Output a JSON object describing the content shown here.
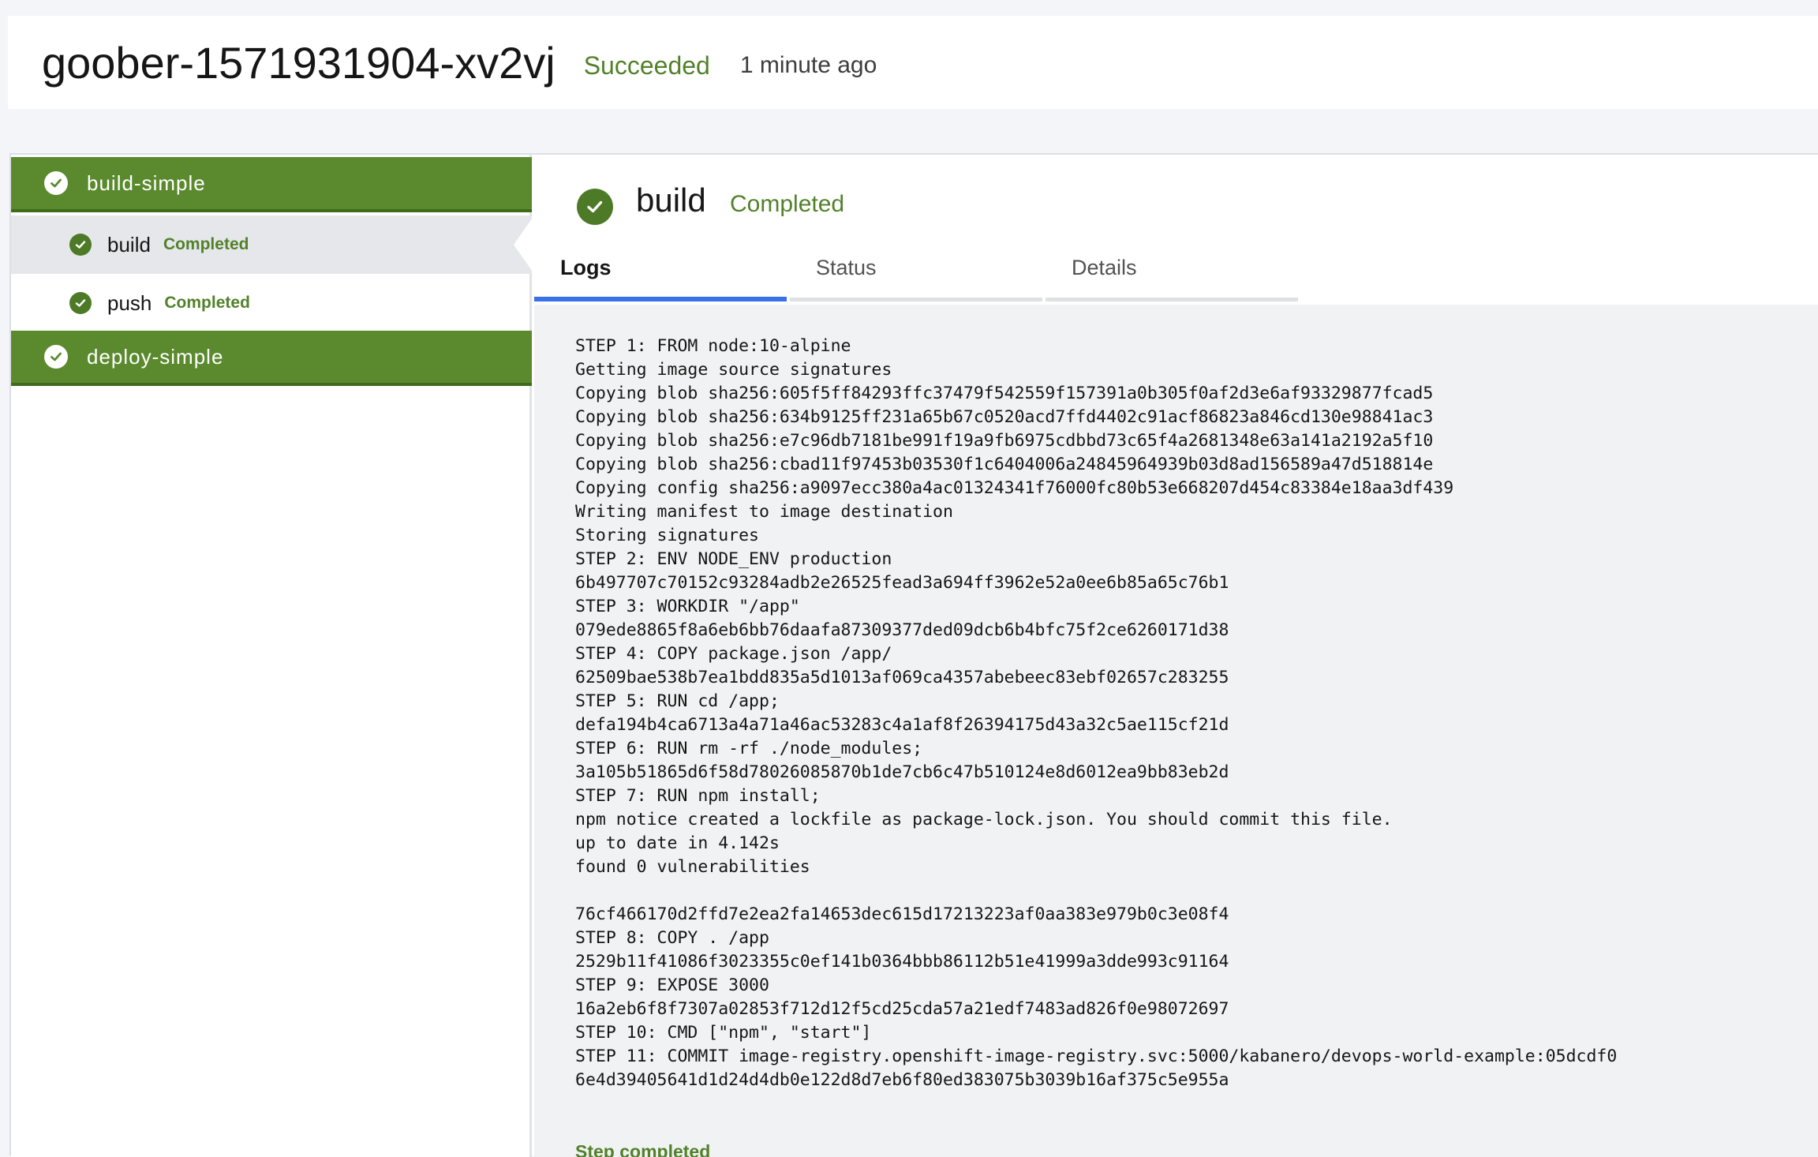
{
  "header": {
    "run_name": "goober-1571931904-xv2vj",
    "status": "Succeeded",
    "time": "1 minute ago"
  },
  "colors": {
    "success": "#52812a",
    "task_bg": "#5a8a2d",
    "tab_active": "#3a71e8"
  },
  "sidebar": {
    "tasks": [
      {
        "label": "build-simple",
        "icon": "check-circle-icon",
        "steps": [
          {
            "label": "build",
            "status": "Completed",
            "selected": true
          },
          {
            "label": "push",
            "status": "Completed",
            "selected": false
          }
        ]
      },
      {
        "label": "deploy-simple",
        "icon": "check-circle-icon",
        "steps": []
      }
    ]
  },
  "step": {
    "title": "build",
    "status": "Completed",
    "tabs": [
      "Logs",
      "Status",
      "Details"
    ],
    "active_tab": "Logs"
  },
  "logs": {
    "lines": [
      "STEP 1: FROM node:10-alpine",
      "Getting image source signatures",
      "Copying blob sha256:605f5ff84293ffc37479f542559f157391a0b305f0af2d3e6af93329877fcad5",
      "Copying blob sha256:634b9125ff231a65b67c0520acd7ffd4402c91acf86823a846cd130e98841ac3",
      "Copying blob sha256:e7c96db7181be991f19a9fb6975cdbbd73c65f4a2681348e63a141a2192a5f10",
      "Copying blob sha256:cbad11f97453b03530f1c6404006a24845964939b03d8ad156589a47d518814e",
      "Copying config sha256:a9097ecc380a4ac01324341f76000fc80b53e668207d454c83384e18aa3df439",
      "Writing manifest to image destination",
      "Storing signatures",
      "STEP 2: ENV NODE_ENV production",
      "6b497707c70152c93284adb2e26525fead3a694ff3962e52a0ee6b85a65c76b1",
      "STEP 3: WORKDIR \"/app\"",
      "079ede8865f8a6eb6bb76daafa87309377ded09dcb6b4bfc75f2ce6260171d38",
      "STEP 4: COPY package.json /app/",
      "62509bae538b7ea1bdd835a5d1013af069ca4357abebeec83ebf02657c283255",
      "STEP 5: RUN cd /app;",
      "defa194b4ca6713a4a71a46ac53283c4a1af8f26394175d43a32c5ae115cf21d",
      "STEP 6: RUN rm -rf ./node_modules;",
      "3a105b51865d6f58d78026085870b1de7cb6c47b510124e8d6012ea9bb83eb2d",
      "STEP 7: RUN npm install;",
      "npm notice created a lockfile as package-lock.json. You should commit this file.",
      "up to date in 4.142s",
      "found 0 vulnerabilities",
      "",
      "76cf466170d2ffd7e2ea2fa14653dec615d17213223af0aa383e979b0c3e08f4",
      "STEP 8: COPY . /app",
      "2529b11f41086f3023355c0ef141b0364bbb86112b51e41999a3dde993c91164",
      "STEP 9: EXPOSE 3000",
      "16a2eb6f8f7307a02853f712d12f5cd25cda57a21edf7483ad826f0e98072697",
      "STEP 10: CMD [\"npm\", \"start\"]",
      "STEP 11: COMMIT image-registry.openshift-image-registry.svc:5000/kabanero/devops-world-example:05dcdf0",
      "6e4d39405641d1d24d4db0e122d8d7eb6f80ed383075b3039b16af375c5e955a"
    ],
    "footer": "Step completed"
  }
}
